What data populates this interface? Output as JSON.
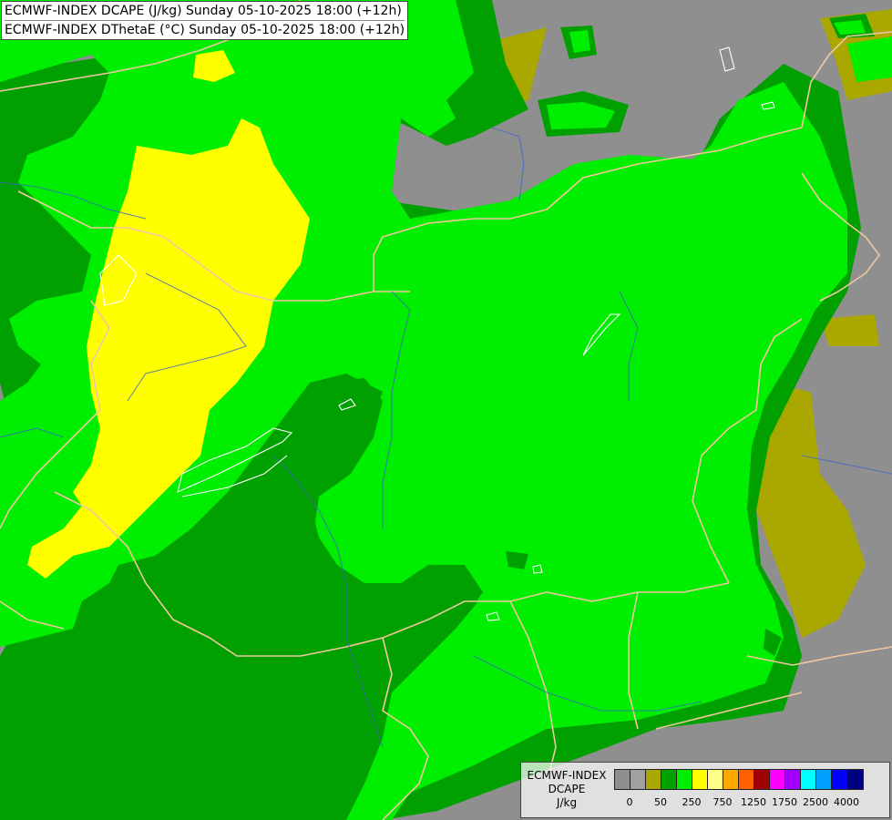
{
  "header": {
    "line1": "ECMWF-INDEX DCAPE (J/kg) Sunday 05-10-2025 18:00 (+12h)",
    "line2": "ECMWF-INDEX DThetaE (°C) Sunday 05-10-2025 18:00 (+12h)"
  },
  "legend": {
    "title_line1": "ECMWF-INDEX",
    "title_line2": "DCAPE",
    "title_line3": "J/kg",
    "colors": [
      "#8f8f8f",
      "#a0a0a0",
      "#aaa800",
      "#00a000",
      "#00ee00",
      "#ffff00",
      "#ffff8a",
      "#ffa800",
      "#ff6000",
      "#a00000",
      "#ff00ff",
      "#a000ff",
      "#00ffff",
      "#00a0ff",
      "#0000ff",
      "#000080"
    ],
    "tick_labels": [
      "0",
      "50",
      "250",
      "750",
      "1250",
      "1750",
      "2500",
      "4000"
    ]
  },
  "map_colors": {
    "no_data": "#8f8f8f",
    "olive": "#aaa800",
    "dark_green": "#00a000",
    "green": "#00ee00",
    "yellow": "#ffff00",
    "borders": "#f0c8a0",
    "rivers": "#3c64c8",
    "isolines": "#ffffff"
  }
}
